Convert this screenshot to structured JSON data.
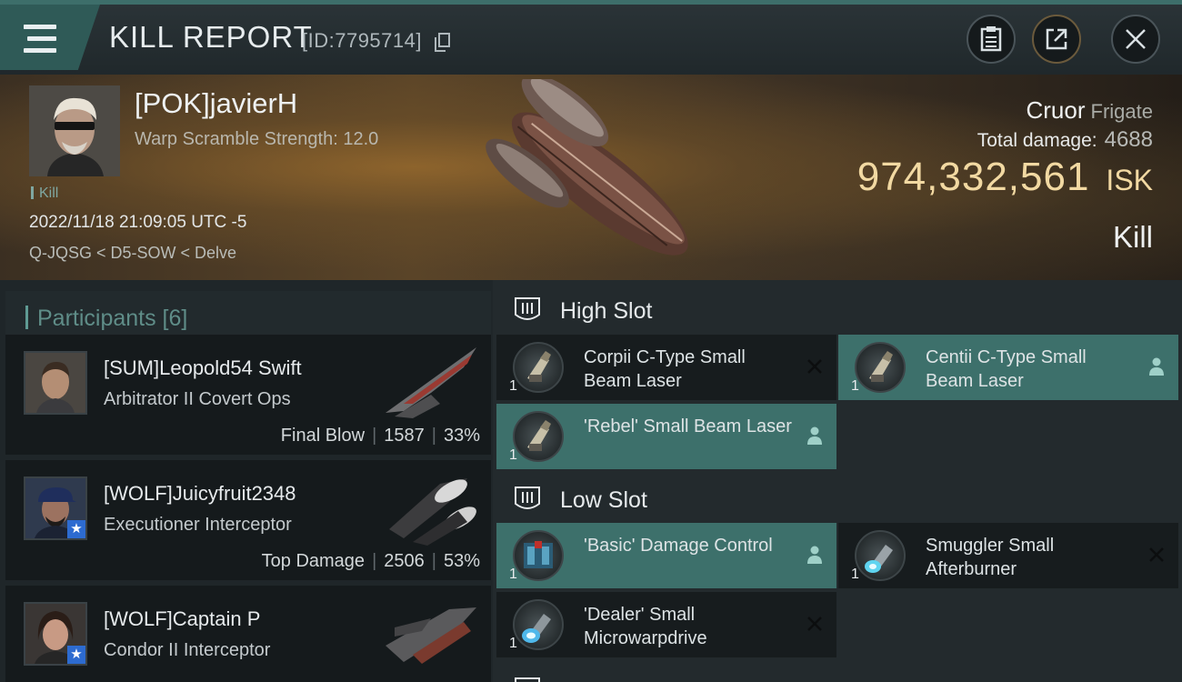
{
  "window": {
    "title": "KILL REPORT",
    "kill_id": "[ID:7795714]"
  },
  "victim": {
    "name": "[POK]javierH",
    "warp_scramble": "Warp Scramble Strength: 12.0",
    "tag": "Kill",
    "datetime": "2022/11/18 21:09:05 UTC -5",
    "location": "Q-JQSG < D5-SOW < Delve",
    "ship": "Cruor",
    "ship_class": "Frigate",
    "total_damage_label": "Total damage:",
    "total_damage": "4688",
    "isk_value": "974,332,561",
    "isk_unit": "ISK",
    "result": "Kill"
  },
  "participants": {
    "title": "Participants [6]",
    "items": [
      {
        "name": "[SUM]Leopold54 Swift",
        "ship": "Arbitrator II Covert Ops",
        "role": "Final Blow",
        "damage": "1587",
        "percent": "33%",
        "star": false
      },
      {
        "name": "[WOLF]Juicyfruit2348",
        "ship": "Executioner Interceptor",
        "role": "Top Damage",
        "damage": "2506",
        "percent": "53%",
        "star": true,
        "star_glyph": "★"
      },
      {
        "name": "[WOLF]Captain P",
        "ship": "Condor II Interceptor",
        "role": "",
        "damage": "",
        "percent": "",
        "star": true,
        "star_glyph": "★"
      }
    ]
  },
  "fitting": {
    "high_slot": {
      "label": "High Slot",
      "modules": [
        {
          "qty": "1",
          "name": "Corpii C-Type Small Beam Laser",
          "status": "destroyed",
          "icon": "laser-icon"
        },
        {
          "qty": "1",
          "name": "Centii C-Type Small Beam Laser",
          "status": "dropped",
          "icon": "laser-icon"
        },
        {
          "qty": "1",
          "name": "'Rebel' Small Beam Laser",
          "status": "dropped",
          "icon": "laser-icon"
        }
      ]
    },
    "low_slot": {
      "label": "Low Slot",
      "modules": [
        {
          "qty": "1",
          "name": "'Basic' Damage Control",
          "status": "dropped",
          "icon": "damage-control-icon"
        },
        {
          "qty": "1",
          "name": "Smuggler Small Afterburner",
          "status": "destroyed",
          "icon": "afterburner-icon"
        },
        {
          "qty": "1",
          "name": "'Dealer' Small Microwarpdrive",
          "status": "destroyed",
          "icon": "microwarpdrive-icon"
        }
      ]
    }
  },
  "colors": {
    "accent_teal": "#3d706b",
    "isk_gold": "#f2d9a2",
    "participants_title": "#5f8d88"
  }
}
